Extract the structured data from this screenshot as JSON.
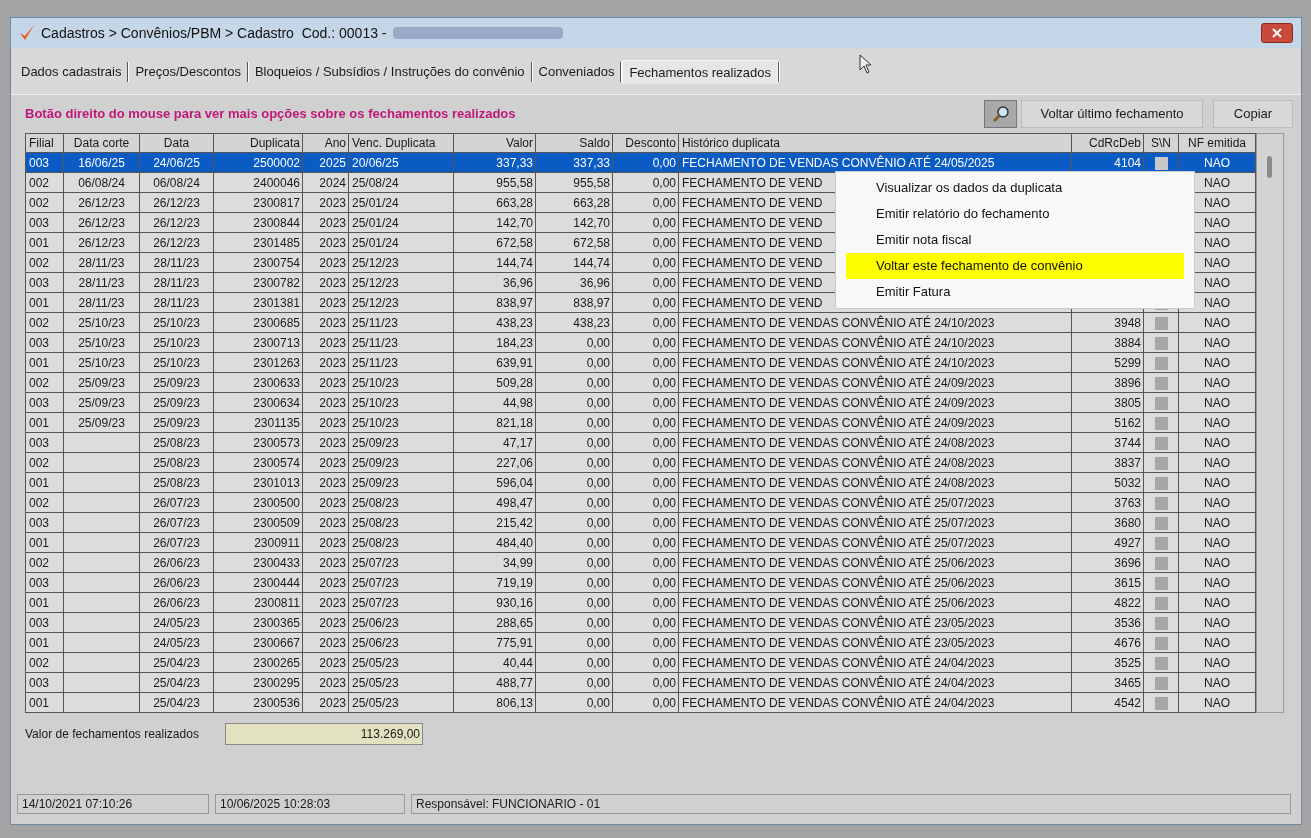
{
  "window": {
    "title": "Cadastros > Convênios/PBM > Cadastro  Cod.: 00013 -",
    "title_redacted": true
  },
  "tabs": [
    {
      "label": "Dados cadastrais",
      "selected": false
    },
    {
      "label": "Preços/Descontos",
      "selected": false
    },
    {
      "label": "Bloqueios / Subsídios / Instruções do convênio",
      "selected": false
    },
    {
      "label": "Conveniados",
      "selected": false
    },
    {
      "label": "Fechamentos realizados",
      "selected": true
    }
  ],
  "hint": "Botão direito do mouse para ver mais opções sobre os fechamentos realizados",
  "toolbar": {
    "buttons": [
      {
        "kind": "icon"
      },
      {
        "kind": "text",
        "label": "Voltar último fechamento"
      },
      {
        "kind": "text",
        "label": "Copiar"
      }
    ]
  },
  "table": {
    "columns": [
      {
        "label": "Filial",
        "kind": "text"
      },
      {
        "label": "Data corte",
        "kind": "center"
      },
      {
        "label": "Data",
        "kind": "center"
      },
      {
        "label": "Duplicata",
        "kind": "number"
      },
      {
        "label": "Ano",
        "kind": "number"
      },
      {
        "label": "Venc. Duplicata",
        "kind": "text"
      },
      {
        "label": "Valor",
        "kind": "number"
      },
      {
        "label": "Saldo",
        "kind": "number"
      },
      {
        "label": "Desconto",
        "kind": "number"
      },
      {
        "label": "Histórico duplicata",
        "kind": "text"
      },
      {
        "label": "CdRcDeb",
        "kind": "number"
      },
      {
        "label": "S\\N",
        "kind": "check"
      },
      {
        "label": "NF emitida",
        "kind": "center"
      }
    ],
    "rows": [
      {
        "selected": true,
        "cells": [
          "003",
          "16/06/25",
          "24/06/25",
          "2500002",
          "2025",
          "20/06/25",
          "337,33",
          "337,33",
          "0,00",
          "FECHAMENTO DE VENDAS CONVÊNIO ATÉ 24/05/2025",
          "4104",
          null,
          "NAO"
        ]
      },
      {
        "selected": false,
        "cells": [
          "002",
          "06/08/24",
          "06/08/24",
          "2400046",
          "2024",
          "25/08/24",
          "955,58",
          "955,58",
          "0,00",
          "FECHAMENTO DE VEND",
          null,
          null,
          "NAO"
        ]
      },
      {
        "selected": false,
        "cells": [
          "002",
          "26/12/23",
          "26/12/23",
          "2300817",
          "2023",
          "25/01/24",
          "663,28",
          "663,28",
          "0,00",
          "FECHAMENTO DE VEND",
          null,
          null,
          "NAO"
        ]
      },
      {
        "selected": false,
        "cells": [
          "003",
          "26/12/23",
          "26/12/23",
          "2300844",
          "2023",
          "25/01/24",
          "142,70",
          "142,70",
          "0,00",
          "FECHAMENTO DE VEND",
          null,
          null,
          "NAO"
        ]
      },
      {
        "selected": false,
        "cells": [
          "001",
          "26/12/23",
          "26/12/23",
          "2301485",
          "2023",
          "25/01/24",
          "672,58",
          "672,58",
          "0,00",
          "FECHAMENTO DE VEND",
          null,
          null,
          "NAO"
        ]
      },
      {
        "selected": false,
        "cells": [
          "002",
          "28/11/23",
          "28/11/23",
          "2300754",
          "2023",
          "25/12/23",
          "144,74",
          "144,74",
          "0,00",
          "FECHAMENTO DE VEND",
          null,
          null,
          "NAO"
        ]
      },
      {
        "selected": false,
        "cells": [
          "003",
          "28/11/23",
          "28/11/23",
          "2300782",
          "2023",
          "25/12/23",
          "36,96",
          "36,96",
          "0,00",
          "FECHAMENTO DE VEND",
          null,
          null,
          "NAO"
        ]
      },
      {
        "selected": false,
        "cells": [
          "001",
          "28/11/23",
          "28/11/23",
          "2301381",
          "2023",
          "25/12/23",
          "838,97",
          "838,97",
          "0,00",
          "FECHAMENTO DE VEND",
          null,
          null,
          "NAO"
        ]
      },
      {
        "selected": false,
        "cells": [
          "002",
          "25/10/23",
          "25/10/23",
          "2300685",
          "2023",
          "25/11/23",
          "438,23",
          "438,23",
          "0,00",
          "FECHAMENTO DE VENDAS CONVÊNIO ATÉ 24/10/2023",
          "3948",
          null,
          "NAO"
        ]
      },
      {
        "selected": false,
        "cells": [
          "003",
          "25/10/23",
          "25/10/23",
          "2300713",
          "2023",
          "25/11/23",
          "184,23",
          "0,00",
          "0,00",
          "FECHAMENTO DE VENDAS CONVÊNIO ATÉ 24/10/2023",
          "3884",
          null,
          "NAO"
        ]
      },
      {
        "selected": false,
        "cells": [
          "001",
          "25/10/23",
          "25/10/23",
          "2301263",
          "2023",
          "25/11/23",
          "639,91",
          "0,00",
          "0,00",
          "FECHAMENTO DE VENDAS CONVÊNIO ATÉ 24/10/2023",
          "5299",
          null,
          "NAO"
        ]
      },
      {
        "selected": false,
        "cells": [
          "002",
          "25/09/23",
          "25/09/23",
          "2300633",
          "2023",
          "25/10/23",
          "509,28",
          "0,00",
          "0,00",
          "FECHAMENTO DE VENDAS CONVÊNIO ATÉ 24/09/2023",
          "3896",
          null,
          "NAO"
        ]
      },
      {
        "selected": false,
        "cells": [
          "003",
          "25/09/23",
          "25/09/23",
          "2300634",
          "2023",
          "25/10/23",
          "44,98",
          "0,00",
          "0,00",
          "FECHAMENTO DE VENDAS CONVÊNIO ATÉ 24/09/2023",
          "3805",
          null,
          "NAO"
        ]
      },
      {
        "selected": false,
        "cells": [
          "001",
          "25/09/23",
          "25/09/23",
          "2301135",
          "2023",
          "25/10/23",
          "821,18",
          "0,00",
          "0,00",
          "FECHAMENTO DE VENDAS CONVÊNIO ATÉ 24/09/2023",
          "5162",
          null,
          "NAO"
        ]
      },
      {
        "selected": false,
        "cells": [
          "003",
          null,
          "25/08/23",
          "2300573",
          "2023",
          "25/09/23",
          "47,17",
          "0,00",
          "0,00",
          "FECHAMENTO DE VENDAS CONVÊNIO ATÉ 24/08/2023",
          "3744",
          null,
          "NAO"
        ]
      },
      {
        "selected": false,
        "cells": [
          "002",
          null,
          "25/08/23",
          "2300574",
          "2023",
          "25/09/23",
          "227,06",
          "0,00",
          "0,00",
          "FECHAMENTO DE VENDAS CONVÊNIO ATÉ 24/08/2023",
          "3837",
          null,
          "NAO"
        ]
      },
      {
        "selected": false,
        "cells": [
          "001",
          null,
          "25/08/23",
          "2301013",
          "2023",
          "25/09/23",
          "596,04",
          "0,00",
          "0,00",
          "FECHAMENTO DE VENDAS CONVÊNIO ATÉ 24/08/2023",
          "5032",
          null,
          "NAO"
        ]
      },
      {
        "selected": false,
        "cells": [
          "002",
          null,
          "26/07/23",
          "2300500",
          "2023",
          "25/08/23",
          "498,47",
          "0,00",
          "0,00",
          "FECHAMENTO DE VENDAS CONVÊNIO ATÉ 25/07/2023",
          "3763",
          null,
          "NAO"
        ]
      },
      {
        "selected": false,
        "cells": [
          "003",
          null,
          "26/07/23",
          "2300509",
          "2023",
          "25/08/23",
          "215,42",
          "0,00",
          "0,00",
          "FECHAMENTO DE VENDAS CONVÊNIO ATÉ 25/07/2023",
          "3680",
          null,
          "NAO"
        ]
      },
      {
        "selected": false,
        "cells": [
          "001",
          null,
          "26/07/23",
          "2300911",
          "2023",
          "25/08/23",
          "484,40",
          "0,00",
          "0,00",
          "FECHAMENTO DE VENDAS CONVÊNIO ATÉ 25/07/2023",
          "4927",
          null,
          "NAO"
        ]
      },
      {
        "selected": false,
        "cells": [
          "002",
          null,
          "26/06/23",
          "2300433",
          "2023",
          "25/07/23",
          "34,99",
          "0,00",
          "0,00",
          "FECHAMENTO DE VENDAS CONVÊNIO ATÉ 25/06/2023",
          "3696",
          null,
          "NAO"
        ]
      },
      {
        "selected": false,
        "cells": [
          "003",
          null,
          "26/06/23",
          "2300444",
          "2023",
          "25/07/23",
          "719,19",
          "0,00",
          "0,00",
          "FECHAMENTO DE VENDAS CONVÊNIO ATÉ 25/06/2023",
          "3615",
          null,
          "NAO"
        ]
      },
      {
        "selected": false,
        "cells": [
          "001",
          null,
          "26/06/23",
          "2300811",
          "2023",
          "25/07/23",
          "930,16",
          "0,00",
          "0,00",
          "FECHAMENTO DE VENDAS CONVÊNIO ATÉ 25/06/2023",
          "4822",
          null,
          "NAO"
        ]
      },
      {
        "selected": false,
        "cells": [
          "003",
          null,
          "24/05/23",
          "2300365",
          "2023",
          "25/06/23",
          "288,65",
          "0,00",
          "0,00",
          "FECHAMENTO DE VENDAS CONVÊNIO ATÉ 23/05/2023",
          "3536",
          null,
          "NAO"
        ]
      },
      {
        "selected": false,
        "cells": [
          "001",
          null,
          "24/05/23",
          "2300667",
          "2023",
          "25/06/23",
          "775,91",
          "0,00",
          "0,00",
          "FECHAMENTO DE VENDAS CONVÊNIO ATÉ 23/05/2023",
          "4676",
          null,
          "NAO"
        ]
      },
      {
        "selected": false,
        "cells": [
          "002",
          null,
          "25/04/23",
          "2300265",
          "2023",
          "25/05/23",
          "40,44",
          "0,00",
          "0,00",
          "FECHAMENTO DE VENDAS CONVÊNIO ATÉ 24/04/2023",
          "3525",
          null,
          "NAO"
        ]
      },
      {
        "selected": false,
        "cells": [
          "003",
          null,
          "25/04/23",
          "2300295",
          "2023",
          "25/05/23",
          "488,77",
          "0,00",
          "0,00",
          "FECHAMENTO DE VENDAS CONVÊNIO ATÉ 24/04/2023",
          "3465",
          null,
          "NAO"
        ]
      },
      {
        "selected": false,
        "cells": [
          "001",
          null,
          "25/04/23",
          "2300536",
          "2023",
          "25/05/23",
          "806,13",
          "0,00",
          "0,00",
          "FECHAMENTO DE VENDAS CONVÊNIO ATÉ 24/04/2023",
          "4542",
          null,
          "NAO"
        ]
      }
    ]
  },
  "context_menu": [
    {
      "label": "Visualizar os dados da duplicata",
      "selected": false
    },
    {
      "label": "Emitir relatório do fechamento",
      "selected": false
    },
    {
      "label": "Emitir nota fiscal",
      "selected": false
    },
    {
      "label": "Voltar este fechamento de convênio",
      "selected": true
    },
    {
      "label": "Emitir Fatura",
      "selected": false
    }
  ],
  "total": {
    "label": "Valor de fechamentos realizados",
    "value": "113.269,00"
  },
  "status_bar": [
    "14/10/2021 07:10:26",
    "10/06/2025 10:28:03",
    "Responsável: FUNCIONARIO - 01"
  ]
}
